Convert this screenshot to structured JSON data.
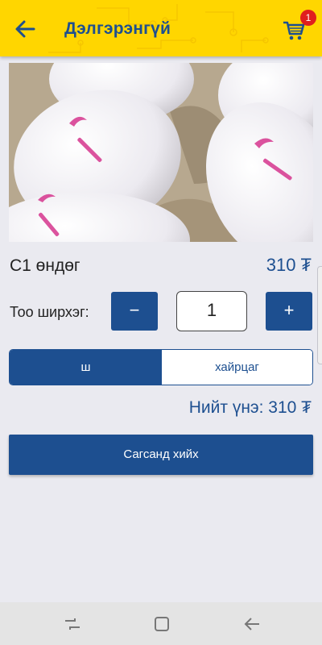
{
  "header": {
    "title": "Дэлгэрэнгүй",
    "cart_count": "1",
    "back_icon": "arrow-left-icon",
    "cart_icon": "shopping-cart-icon"
  },
  "product": {
    "image": "eggs-photo",
    "name": "С1 өндөг",
    "price": "310 ₮"
  },
  "quantity": {
    "label": "Тоо ширхэг:",
    "minus": "−",
    "value": "1",
    "plus": "+"
  },
  "units": {
    "options": [
      "ш",
      "хайрцаг"
    ],
    "selected": "ш"
  },
  "total": "Нийт үнэ: 310 ₮",
  "add_to_cart": "Сагсанд хийх",
  "nav": {
    "recent_icon": "recent-apps-icon",
    "home_icon": "home-icon",
    "back_icon": "nav-back-icon"
  },
  "colors": {
    "header_bg": "#ffd600",
    "primary": "#1d4f90",
    "badge": "#e01e1e",
    "background": "#eaeaf0"
  }
}
